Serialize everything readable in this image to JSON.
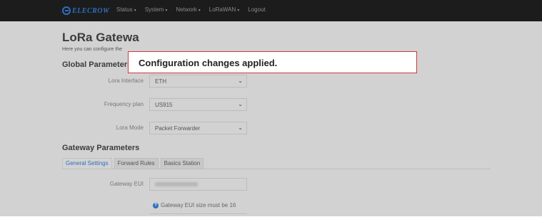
{
  "header": {
    "logo_text": "ELECROW",
    "menu": [
      {
        "label": "Status",
        "caret": "▾"
      },
      {
        "label": "System",
        "caret": "▾"
      },
      {
        "label": "Network",
        "caret": "▾"
      },
      {
        "label": "LoRaWAN",
        "caret": "▾"
      },
      {
        "label": "Logout",
        "caret": ""
      }
    ]
  },
  "page": {
    "title": "LoRa Gatewa",
    "description": "Here you can configure the"
  },
  "global": {
    "heading": "Global Parameters",
    "fields": [
      {
        "label": "Lora Interface",
        "value": "ETH"
      },
      {
        "label": "Frequency plan",
        "value": "US915"
      },
      {
        "label": "Lora Mode",
        "value": "Packet Forwarder"
      }
    ]
  },
  "gateway": {
    "heading": "Gateway Parameters",
    "tabs": [
      "General Settings",
      "Forward Rules",
      "Basics Station"
    ],
    "eui_label": "Gateway EUI",
    "eui_hint": "Gateway EUI size must be 16"
  },
  "toast": {
    "message": "Configuration changes applied."
  },
  "colors": {
    "accent": "#2f6fbf",
    "toast_border": "#d03a3a",
    "overlay": "#d2d2d2",
    "topbar": "#1c1c1c"
  }
}
